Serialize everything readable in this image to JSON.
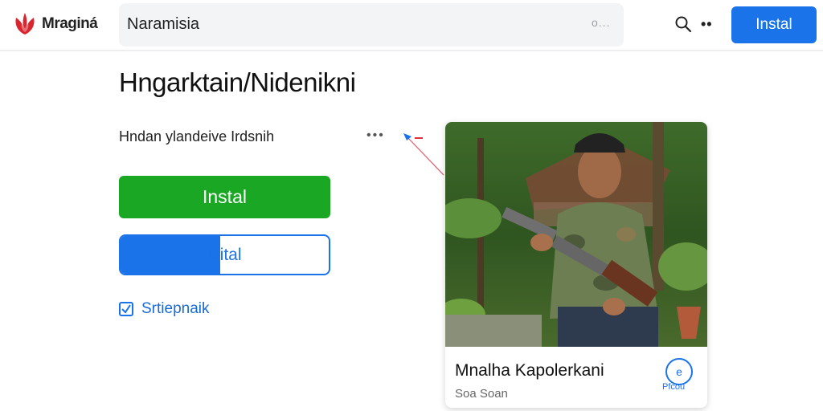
{
  "brand": {
    "name": "Mraginá",
    "accent": "#d9262e"
  },
  "search": {
    "text": "Naramisia",
    "dots": "o..."
  },
  "header": {
    "install_label": "Instal",
    "more_icon": "more-dots-icon",
    "search_icon": "search-icon"
  },
  "main": {
    "title": "Hngarktain/Nidenikni",
    "subtitle": "Hndan ylandeive Irdsnih",
    "primary_button": "Instal",
    "secondary_button": {
      "label": "Nital",
      "progress": 0.48
    },
    "checkbox": {
      "label": "Srtiepnaik",
      "checked": true
    }
  },
  "card": {
    "title": "Mnalha Kapolerkani",
    "subtitle": "Soa Soan",
    "badge_text": "Pfcou"
  },
  "colors": {
    "primary": "#1a73e8",
    "green": "#1aa824",
    "brand_red": "#d9262e"
  }
}
